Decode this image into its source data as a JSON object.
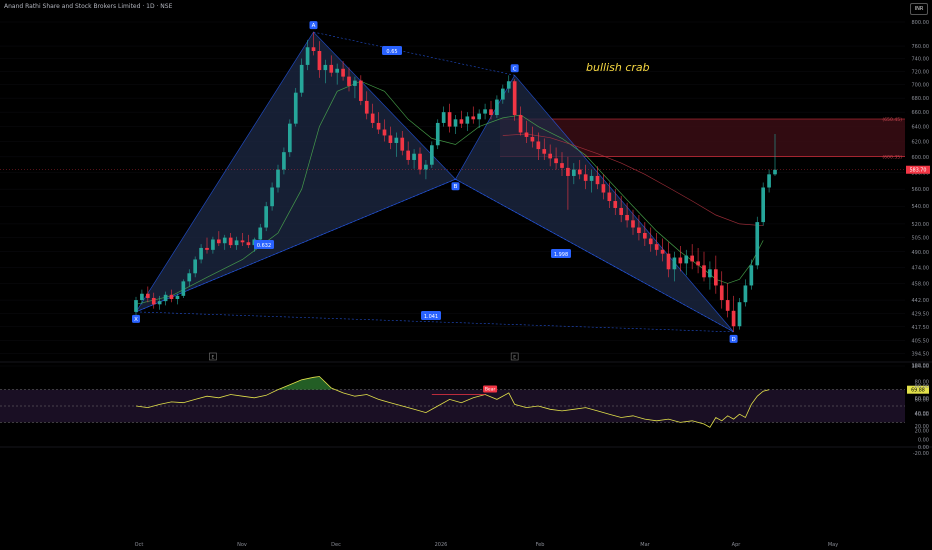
{
  "header": {
    "symbol_title": "Anand Rathi Share and Stock Brokers Limited · 1D · NSE",
    "currency": "INR"
  },
  "colors": {
    "background": "#000000",
    "up_candle": "#26a69a",
    "down_candle": "#f23645",
    "pattern_fill": "#1e2a46",
    "pattern_line": "#2962ff",
    "point_label_bg": "#2962ff",
    "zone_fill": "#3a0d14",
    "zone_line": "#f23645",
    "ma_fast": "#4caf50",
    "ma_slow": "#b2323f",
    "rsi_line": "#e2e04a",
    "rsi_band": "#1a0f24",
    "annotation_text": "#f5d742"
  },
  "chart_data": [
    {
      "type": "candlestick",
      "title": "Anand Rathi Share and Stock Brokers Limited · 1D · NSE",
      "x_tick_labels": [
        "Oct",
        "Nov",
        "Dec",
        "2026",
        "Feb",
        "Mar",
        "Apr",
        "May"
      ],
      "y_tick_labels": [
        "800.00",
        "760.00",
        "740.00",
        "720.00",
        "700.00",
        "680.00",
        "660.00",
        "640.00",
        "620.00",
        "600.00",
        "580.00",
        "560.00",
        "540.00",
        "520.00",
        "505.00",
        "490.00",
        "474.00",
        "458.00",
        "442.00",
        "429.50",
        "417.50",
        "405.50",
        "394.50",
        "384.00"
      ],
      "y_ticks": [
        800,
        760,
        740,
        720,
        700,
        680,
        660,
        640,
        620,
        600,
        580,
        560,
        540,
        520,
        505,
        490,
        474,
        458,
        442,
        429.5,
        417.5,
        405.5,
        394.5,
        384
      ],
      "last_price_label": "583.70",
      "last_price": 583.7,
      "annotation": "bullish crab",
      "pattern_points": [
        {
          "label": "X",
          "price": 431
        },
        {
          "label": "A",
          "price": 783
        },
        {
          "label": "B",
          "price": 572
        },
        {
          "label": "C",
          "price": 714
        },
        {
          "label": "D",
          "price": 413
        }
      ],
      "pattern_ratios": [
        {
          "label": "0.65"
        },
        {
          "label": "0.632"
        },
        {
          "label": "1.998"
        },
        {
          "label": "1.041"
        }
      ],
      "zone": {
        "upper_label": "(650.45)",
        "lower_label": "(600.35)",
        "upper": 650.45,
        "lower": 600.35
      },
      "event_markers": [
        "E",
        "E"
      ],
      "candles": [
        [
          431,
          445,
          428,
          442
        ],
        [
          442,
          452,
          438,
          448
        ],
        [
          448,
          455,
          440,
          444
        ],
        [
          444,
          449,
          434,
          438
        ],
        [
          438,
          446,
          433,
          441
        ],
        [
          441,
          450,
          437,
          447
        ],
        [
          447,
          452,
          440,
          443
        ],
        [
          443,
          448,
          438,
          446
        ],
        [
          446,
          462,
          444,
          460
        ],
        [
          460,
          472,
          455,
          468
        ],
        [
          468,
          485,
          464,
          482
        ],
        [
          482,
          498,
          478,
          494
        ],
        [
          494,
          505,
          488,
          492
        ],
        [
          492,
          506,
          488,
          503
        ],
        [
          503,
          512,
          496,
          499
        ],
        [
          499,
          508,
          492,
          505
        ],
        [
          505,
          510,
          494,
          497
        ],
        [
          497,
          506,
          492,
          502
        ],
        [
          502,
          510,
          496,
          500
        ],
        [
          500,
          508,
          494,
          497
        ],
        [
          497,
          505,
          490,
          503
        ],
        [
          503,
          520,
          500,
          516
        ],
        [
          516,
          545,
          512,
          540
        ],
        [
          540,
          568,
          535,
          562
        ],
        [
          562,
          590,
          556,
          584
        ],
        [
          584,
          612,
          578,
          606
        ],
        [
          606,
          650,
          600,
          644
        ],
        [
          644,
          695,
          640,
          688
        ],
        [
          688,
          740,
          682,
          730
        ],
        [
          730,
          770,
          722,
          758
        ],
        [
          758,
          783,
          745,
          752
        ],
        [
          752,
          768,
          710,
          722
        ],
        [
          722,
          738,
          702,
          730
        ],
        [
          730,
          745,
          712,
          718
        ],
        [
          718,
          732,
          700,
          724
        ],
        [
          724,
          736,
          706,
          712
        ],
        [
          712,
          726,
          690,
          698
        ],
        [
          698,
          712,
          680,
          706
        ],
        [
          706,
          714,
          670,
          676
        ],
        [
          676,
          690,
          650,
          658
        ],
        [
          658,
          672,
          638,
          645
        ],
        [
          645,
          660,
          630,
          636
        ],
        [
          636,
          650,
          620,
          628
        ],
        [
          628,
          640,
          610,
          618
        ],
        [
          618,
          632,
          600,
          625
        ],
        [
          625,
          634,
          602,
          608
        ],
        [
          608,
          620,
          590,
          596
        ],
        [
          596,
          610,
          585,
          604
        ],
        [
          604,
          612,
          578,
          584
        ],
        [
          584,
          596,
          572,
          590
        ],
        [
          590,
          620,
          586,
          615
        ],
        [
          615,
          650,
          610,
          645
        ],
        [
          645,
          668,
          640,
          660
        ],
        [
          660,
          672,
          632,
          640
        ],
        [
          640,
          656,
          630,
          650
        ],
        [
          650,
          662,
          638,
          644
        ],
        [
          644,
          660,
          634,
          654
        ],
        [
          654,
          668,
          644,
          650
        ],
        [
          650,
          664,
          638,
          658
        ],
        [
          658,
          672,
          650,
          664
        ],
        [
          664,
          676,
          650,
          656
        ],
        [
          656,
          684,
          652,
          678
        ],
        [
          678,
          700,
          672,
          694
        ],
        [
          694,
          714,
          688,
          705
        ],
        [
          705,
          708,
          648,
          656
        ],
        [
          656,
          668,
          628,
          632
        ],
        [
          632,
          648,
          618,
          626
        ],
        [
          626,
          640,
          612,
          620
        ],
        [
          620,
          632,
          596,
          610
        ],
        [
          610,
          624,
          596,
          604
        ],
        [
          604,
          616,
          588,
          598
        ],
        [
          598,
          612,
          584,
          592
        ],
        [
          592,
          606,
          576,
          586
        ],
        [
          586,
          600,
          536,
          576
        ],
        [
          576,
          592,
          566,
          584
        ],
        [
          584,
          596,
          572,
          578
        ],
        [
          578,
          590,
          560,
          570
        ],
        [
          570,
          584,
          556,
          576
        ],
        [
          576,
          588,
          560,
          566
        ],
        [
          566,
          578,
          548,
          556
        ],
        [
          556,
          568,
          538,
          546
        ],
        [
          546,
          560,
          530,
          538
        ],
        [
          538,
          552,
          522,
          530
        ],
        [
          530,
          544,
          516,
          524
        ],
        [
          524,
          536,
          508,
          516
        ],
        [
          516,
          530,
          502,
          510
        ],
        [
          510,
          522,
          496,
          504
        ],
        [
          504,
          516,
          490,
          498
        ],
        [
          498,
          510,
          486,
          492
        ],
        [
          492,
          504,
          480,
          488
        ],
        [
          488,
          500,
          464,
          472
        ],
        [
          472,
          490,
          460,
          484
        ],
        [
          484,
          496,
          470,
          478
        ],
        [
          478,
          492,
          466,
          486
        ],
        [
          486,
          498,
          472,
          480
        ],
        [
          480,
          494,
          468,
          476
        ],
        [
          476,
          490,
          460,
          464
        ],
        [
          464,
          480,
          452,
          472
        ],
        [
          472,
          486,
          448,
          456
        ],
        [
          456,
          470,
          434,
          442
        ],
        [
          442,
          458,
          426,
          432
        ],
        [
          432,
          446,
          413,
          418
        ],
        [
          418,
          444,
          415,
          440
        ],
        [
          440,
          462,
          436,
          456
        ],
        [
          456,
          482,
          452,
          476
        ],
        [
          476,
          528,
          472,
          522
        ],
        [
          522,
          568,
          518,
          562
        ],
        [
          562,
          584,
          556,
          578
        ],
        [
          578,
          630,
          576,
          583.7
        ]
      ],
      "moving_averages": [
        {
          "name": "fast",
          "values": [
            [
              0,
              438
            ],
            [
              6,
              446
            ],
            [
              12,
              464
            ],
            [
              18,
              482
            ],
            [
              24,
              510
            ],
            [
              28,
              560
            ],
            [
              31,
              640
            ],
            [
              34,
              690
            ],
            [
              38,
              705
            ],
            [
              42,
              690
            ],
            [
              46,
              650
            ],
            [
              50,
              624
            ],
            [
              54,
              616
            ],
            [
              58,
              640
            ],
            [
              62,
              652
            ],
            [
              65,
              656
            ],
            [
              68,
              640
            ],
            [
              72,
              624
            ],
            [
              76,
              602
            ],
            [
              80,
              570
            ],
            [
              84,
              540
            ],
            [
              88,
              512
            ],
            [
              92,
              490
            ],
            [
              96,
              472
            ],
            [
              98,
              462
            ],
            [
              100,
              458
            ],
            [
              102,
              462
            ],
            [
              104,
              478
            ],
            [
              106,
              502
            ]
          ]
        },
        {
          "name": "slow",
          "values": [
            [
              62,
              628
            ],
            [
              66,
              630
            ],
            [
              70,
              625
            ],
            [
              74,
              615
            ],
            [
              78,
              604
            ],
            [
              82,
              592
            ],
            [
              86,
              578
            ],
            [
              90,
              562
            ],
            [
              94,
              546
            ],
            [
              98,
              530
            ],
            [
              102,
              520
            ],
            [
              106,
              518
            ]
          ]
        }
      ]
    },
    {
      "type": "line",
      "title": "",
      "y_tick_labels": [
        "100.00",
        "80.00",
        "60.00",
        "40.00",
        "20.00",
        "0.00"
      ],
      "y_ticks": [
        100,
        80,
        60,
        40,
        20,
        0
      ],
      "last_value_label": "69.88",
      "last_value": 69.88,
      "band": [
        30,
        70
      ],
      "midline": 50,
      "divergence_label": "Bear",
      "values": [
        [
          0,
          50
        ],
        [
          2,
          48
        ],
        [
          4,
          52
        ],
        [
          6,
          55
        ],
        [
          8,
          54
        ],
        [
          10,
          58
        ],
        [
          12,
          62
        ],
        [
          14,
          60
        ],
        [
          16,
          64
        ],
        [
          18,
          62
        ],
        [
          20,
          60
        ],
        [
          22,
          63
        ],
        [
          24,
          70
        ],
        [
          26,
          76
        ],
        [
          28,
          82
        ],
        [
          30,
          85
        ],
        [
          31,
          86
        ],
        [
          33,
          72
        ],
        [
          35,
          66
        ],
        [
          37,
          62
        ],
        [
          39,
          64
        ],
        [
          41,
          58
        ],
        [
          43,
          54
        ],
        [
          45,
          50
        ],
        [
          47,
          46
        ],
        [
          49,
          42
        ],
        [
          51,
          50
        ],
        [
          53,
          58
        ],
        [
          55,
          54
        ],
        [
          57,
          60
        ],
        [
          59,
          64
        ],
        [
          61,
          58
        ],
        [
          63,
          66
        ],
        [
          64,
          52
        ],
        [
          66,
          48
        ],
        [
          68,
          50
        ],
        [
          70,
          46
        ],
        [
          72,
          44
        ],
        [
          74,
          46
        ],
        [
          76,
          48
        ],
        [
          78,
          44
        ],
        [
          80,
          40
        ],
        [
          82,
          36
        ],
        [
          84,
          38
        ],
        [
          86,
          34
        ],
        [
          88,
          32
        ],
        [
          90,
          34
        ],
        [
          92,
          30
        ],
        [
          94,
          32
        ],
        [
          96,
          28
        ],
        [
          97,
          24
        ],
        [
          98,
          36
        ],
        [
          99,
          32
        ],
        [
          100,
          38
        ],
        [
          101,
          34
        ],
        [
          102,
          40
        ],
        [
          103,
          36
        ],
        [
          104,
          52
        ],
        [
          105,
          62
        ],
        [
          106,
          68
        ],
        [
          107,
          69.88
        ]
      ]
    },
    {
      "type": "line",
      "title": "",
      "y_tick_labels": [
        "80.00",
        "60.00",
        "40.00",
        "20.00",
        "0.00",
        "-20.00"
      ],
      "y_ticks": [
        80,
        60,
        40,
        20,
        0,
        -20
      ],
      "values": []
    }
  ]
}
